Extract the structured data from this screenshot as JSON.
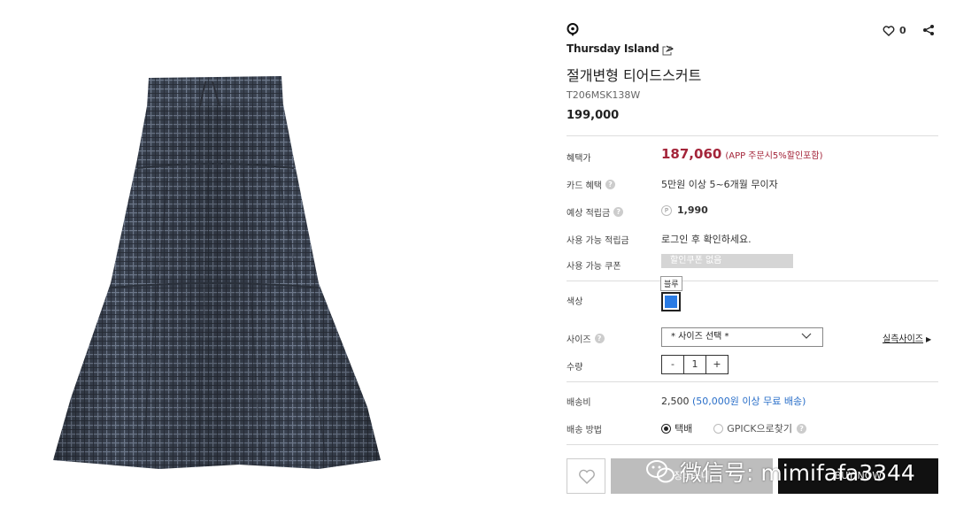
{
  "product_image": {
    "alt": "tiered skirt"
  },
  "brand": {
    "name": "Thursday Island",
    "arrow": ">"
  },
  "wishlist": {
    "count": "0"
  },
  "product": {
    "name": "절개변형 티어드스커트",
    "code": "T206MSK138W",
    "price": "199,000"
  },
  "benefit": {
    "label": "혜택가",
    "price": "187,060",
    "note": "(APP 주문시5%할인포함)"
  },
  "card": {
    "label": "카드 혜택",
    "value": "5만원 이상 5~6개월 무이자"
  },
  "points": {
    "label": "예상 적립금",
    "badge": "P",
    "value": "1,990"
  },
  "usable_points": {
    "label": "사용 가능 적립금",
    "value": "로그인 후 확인하세요."
  },
  "coupon": {
    "label": "사용 가능 쿠폰",
    "value": "할인쿠폰 없음"
  },
  "color": {
    "label": "색상",
    "tooltip": "블루",
    "swatch": "#2a7be4"
  },
  "size": {
    "label": "사이즈",
    "select": "* 사이즈 선택 *",
    "chart": "실측사이즈"
  },
  "quantity": {
    "label": "수량",
    "minus": "-",
    "value": "1",
    "plus": "+"
  },
  "shipping": {
    "label": "배송비",
    "fee": "2,500",
    "free": "(50,000원 이상 무료 배송)"
  },
  "delivery": {
    "label": "배송 방법",
    "option1": "택배",
    "option2": "GPICK으로찾기"
  },
  "actions": {
    "cart": "장바구니",
    "buy": "BUY NOW"
  },
  "watermark": {
    "text": "微信号: mimifafa3344"
  },
  "colors": {
    "accent_price": "#a4253a",
    "link": "#2a6fc9",
    "swatch_blue": "#2a7be4"
  }
}
